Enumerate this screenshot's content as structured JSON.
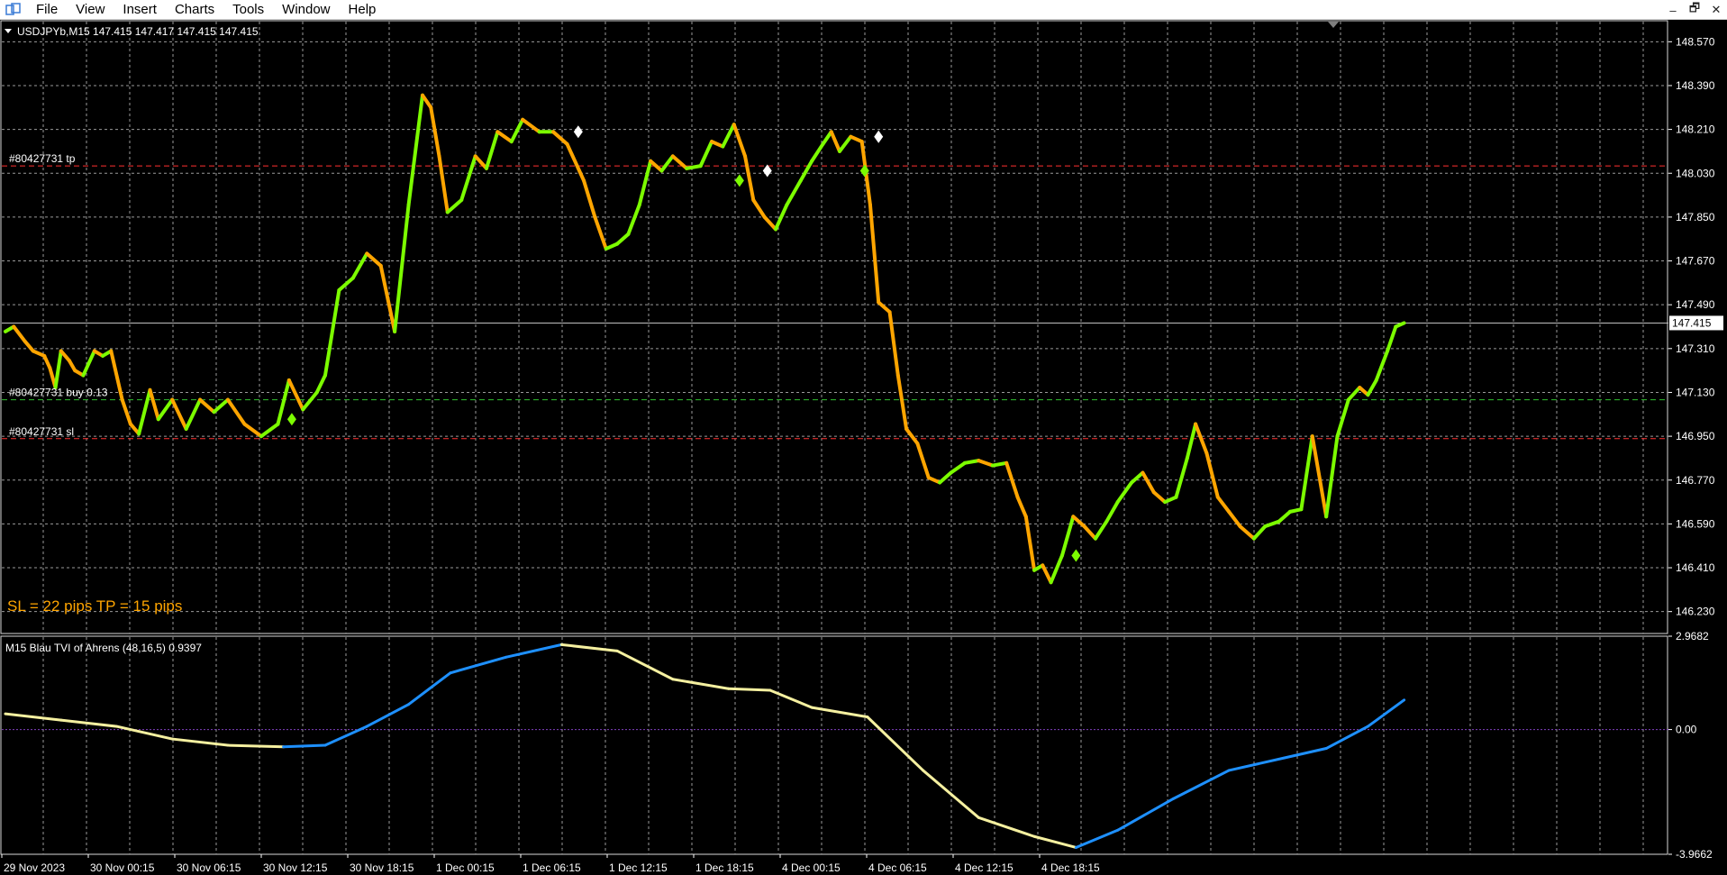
{
  "menu": {
    "items": [
      "File",
      "View",
      "Insert",
      "Charts",
      "Tools",
      "Window",
      "Help"
    ],
    "controls": [
      "–",
      "🗗",
      "✕"
    ]
  },
  "chart_data": [
    {
      "type": "line",
      "title": "USDJPYb,M15  147.415 147.417 147.415 147.415",
      "ylim": [
        146.14,
        148.66
      ],
      "y_ticks": [
        "148.570",
        "148.390",
        "148.210",
        "148.030",
        "147.850",
        "147.670",
        "147.490",
        "147.310",
        "147.130",
        "146.950",
        "146.770",
        "146.590",
        "146.410",
        "146.230"
      ],
      "x_ticks": [
        "29 Nov 2023",
        "30 Nov 00:15",
        "30 Nov 06:15",
        "30 Nov 12:15",
        "30 Nov 18:15",
        "1 Dec 00:15",
        "1 Dec 06:15",
        "1 Dec 12:15",
        "1 Dec 18:15",
        "4 Dec 00:15",
        "4 Dec 06:15",
        "4 Dec 12:15",
        "4 Dec 18:15"
      ],
      "current_price_label": "147.415",
      "current_price": 147.415,
      "levels": [
        {
          "label": "#80427731 tp",
          "value": 148.06,
          "color": "#ff3030"
        },
        {
          "label": "#80427731 buy 0.13",
          "value": 147.1,
          "color": "#30c030"
        },
        {
          "label": "#80427731 sl",
          "value": 146.94,
          "color": "#ff3030"
        }
      ],
      "annotation": "SL = 22 pips      TP = 15 pips",
      "colors": {
        "up": "#7cfc00",
        "down": "#ffa500",
        "grid": "#9a9a9a",
        "background": "#000000"
      },
      "series": [
        {
          "x": 0,
          "y": 147.38
        },
        {
          "x": 0.3,
          "y": 147.4
        },
        {
          "x": 0.7,
          "y": 147.34
        },
        {
          "x": 1.0,
          "y": 147.3
        },
        {
          "x": 1.4,
          "y": 147.28
        },
        {
          "x": 1.6,
          "y": 147.23
        },
        {
          "x": 1.8,
          "y": 147.15
        },
        {
          "x": 2.0,
          "y": 147.3
        },
        {
          "x": 2.3,
          "y": 147.26
        },
        {
          "x": 2.5,
          "y": 147.22
        },
        {
          "x": 2.8,
          "y": 147.2
        },
        {
          "x": 3.2,
          "y": 147.3
        },
        {
          "x": 3.5,
          "y": 147.28
        },
        {
          "x": 3.8,
          "y": 147.3
        },
        {
          "x": 4.2,
          "y": 147.1
        },
        {
          "x": 4.5,
          "y": 147.0
        },
        {
          "x": 4.8,
          "y": 146.96
        },
        {
          "x": 5.2,
          "y": 147.14
        },
        {
          "x": 5.5,
          "y": 147.02
        },
        {
          "x": 6.0,
          "y": 147.1
        },
        {
          "x": 6.5,
          "y": 146.98
        },
        {
          "x": 7.0,
          "y": 147.1
        },
        {
          "x": 7.5,
          "y": 147.05
        },
        {
          "x": 8.0,
          "y": 147.1
        },
        {
          "x": 8.6,
          "y": 147.0
        },
        {
          "x": 9.2,
          "y": 146.95
        },
        {
          "x": 9.8,
          "y": 147.0
        },
        {
          "x": 10.2,
          "y": 147.18
        },
        {
          "x": 10.7,
          "y": 147.06
        },
        {
          "x": 11.2,
          "y": 147.13
        },
        {
          "x": 11.5,
          "y": 147.2
        },
        {
          "x": 12.0,
          "y": 147.55
        },
        {
          "x": 12.5,
          "y": 147.6
        },
        {
          "x": 13.0,
          "y": 147.7
        },
        {
          "x": 13.5,
          "y": 147.65
        },
        {
          "x": 14.0,
          "y": 147.38
        },
        {
          "x": 14.5,
          "y": 147.9
        },
        {
          "x": 15.0,
          "y": 148.35
        },
        {
          "x": 15.3,
          "y": 148.3
        },
        {
          "x": 15.6,
          "y": 148.1
        },
        {
          "x": 15.9,
          "y": 147.87
        },
        {
          "x": 16.4,
          "y": 147.92
        },
        {
          "x": 16.9,
          "y": 148.1
        },
        {
          "x": 17.3,
          "y": 148.05
        },
        {
          "x": 17.7,
          "y": 148.2
        },
        {
          "x": 18.2,
          "y": 148.16
        },
        {
          "x": 18.6,
          "y": 148.25
        },
        {
          "x": 19.2,
          "y": 148.2
        },
        {
          "x": 19.7,
          "y": 148.2
        },
        {
          "x": 20.2,
          "y": 148.15
        },
        {
          "x": 20.8,
          "y": 148.0
        },
        {
          "x": 21.2,
          "y": 147.85
        },
        {
          "x": 21.6,
          "y": 147.72
        },
        {
          "x": 22.0,
          "y": 147.74
        },
        {
          "x": 22.4,
          "y": 147.78
        },
        {
          "x": 22.8,
          "y": 147.9
        },
        {
          "x": 23.2,
          "y": 148.08
        },
        {
          "x": 23.6,
          "y": 148.04
        },
        {
          "x": 24.0,
          "y": 148.1
        },
        {
          "x": 24.5,
          "y": 148.05
        },
        {
          "x": 25.0,
          "y": 148.06
        },
        {
          "x": 25.4,
          "y": 148.16
        },
        {
          "x": 25.8,
          "y": 148.14
        },
        {
          "x": 26.2,
          "y": 148.23
        },
        {
          "x": 26.6,
          "y": 148.1
        },
        {
          "x": 26.9,
          "y": 147.92
        },
        {
          "x": 27.3,
          "y": 147.85
        },
        {
          "x": 27.7,
          "y": 147.8
        },
        {
          "x": 28.1,
          "y": 147.9
        },
        {
          "x": 28.6,
          "y": 148.0
        },
        {
          "x": 29.0,
          "y": 148.08
        },
        {
          "x": 29.4,
          "y": 148.15
        },
        {
          "x": 29.7,
          "y": 148.2
        },
        {
          "x": 30.0,
          "y": 148.12
        },
        {
          "x": 30.4,
          "y": 148.18
        },
        {
          "x": 30.8,
          "y": 148.16
        },
        {
          "x": 31.1,
          "y": 147.9
        },
        {
          "x": 31.4,
          "y": 147.5
        },
        {
          "x": 31.8,
          "y": 147.46
        },
        {
          "x": 32.1,
          "y": 147.2
        },
        {
          "x": 32.4,
          "y": 146.98
        },
        {
          "x": 32.8,
          "y": 146.92
        },
        {
          "x": 33.2,
          "y": 146.78
        },
        {
          "x": 33.6,
          "y": 146.76
        },
        {
          "x": 34.0,
          "y": 146.8
        },
        {
          "x": 34.5,
          "y": 146.84
        },
        {
          "x": 35.0,
          "y": 146.85
        },
        {
          "x": 35.5,
          "y": 146.83
        },
        {
          "x": 36.0,
          "y": 146.84
        },
        {
          "x": 36.4,
          "y": 146.7
        },
        {
          "x": 36.7,
          "y": 146.62
        },
        {
          "x": 37.0,
          "y": 146.4
        },
        {
          "x": 37.3,
          "y": 146.42
        },
        {
          "x": 37.6,
          "y": 146.35
        },
        {
          "x": 38.0,
          "y": 146.46
        },
        {
          "x": 38.4,
          "y": 146.62
        },
        {
          "x": 38.8,
          "y": 146.58
        },
        {
          "x": 39.2,
          "y": 146.53
        },
        {
          "x": 39.6,
          "y": 146.6
        },
        {
          "x": 40.0,
          "y": 146.68
        },
        {
          "x": 40.5,
          "y": 146.76
        },
        {
          "x": 40.9,
          "y": 146.8
        },
        {
          "x": 41.3,
          "y": 146.72
        },
        {
          "x": 41.7,
          "y": 146.68
        },
        {
          "x": 42.1,
          "y": 146.7
        },
        {
          "x": 42.5,
          "y": 146.86
        },
        {
          "x": 42.8,
          "y": 147.0
        },
        {
          "x": 43.2,
          "y": 146.88
        },
        {
          "x": 43.6,
          "y": 146.7
        },
        {
          "x": 44.0,
          "y": 146.64
        },
        {
          "x": 44.4,
          "y": 146.58
        },
        {
          "x": 44.9,
          "y": 146.53
        },
        {
          "x": 45.3,
          "y": 146.58
        },
        {
          "x": 45.8,
          "y": 146.6
        },
        {
          "x": 46.2,
          "y": 146.64
        },
        {
          "x": 46.6,
          "y": 146.65
        },
        {
          "x": 47.0,
          "y": 146.95
        },
        {
          "x": 47.5,
          "y": 146.62
        },
        {
          "x": 47.9,
          "y": 146.95
        },
        {
          "x": 48.3,
          "y": 147.1
        },
        {
          "x": 48.7,
          "y": 147.15
        },
        {
          "x": 49.0,
          "y": 147.12
        },
        {
          "x": 49.3,
          "y": 147.18
        },
        {
          "x": 49.7,
          "y": 147.3
        },
        {
          "x": 50.0,
          "y": 147.4
        },
        {
          "x": 50.3,
          "y": 147.415
        }
      ],
      "signal_markers": [
        {
          "x": 10.3,
          "y": 147.02,
          "color": "#7cfc00"
        },
        {
          "x": 20.6,
          "y": 148.2,
          "color": "#ffffff"
        },
        {
          "x": 26.4,
          "y": 148.0,
          "color": "#7cfc00"
        },
        {
          "x": 27.4,
          "y": 148.04,
          "color": "#ffffff"
        },
        {
          "x": 30.9,
          "y": 148.04,
          "color": "#7cfc00"
        },
        {
          "x": 31.4,
          "y": 148.18,
          "color": "#ffffff"
        },
        {
          "x": 38.5,
          "y": 146.46,
          "color": "#7cfc00"
        }
      ]
    },
    {
      "type": "line",
      "title": "M15 Blau TVI of Ahrens (48,16,5) 0.9397",
      "ylim": [
        -3.9662,
        2.9682
      ],
      "y_ticks": [
        "2.9682",
        "0.00",
        "-3.9662"
      ],
      "zero_line": 0.0,
      "colors": {
        "up": "#1e90ff",
        "down": "#f5f0a0",
        "zero": "#8040c0"
      },
      "series": [
        {
          "x": 0,
          "y": 0.5
        },
        {
          "x": 2,
          "y": 0.3
        },
        {
          "x": 4,
          "y": 0.1
        },
        {
          "x": 6,
          "y": -0.3
        },
        {
          "x": 8,
          "y": -0.5
        },
        {
          "x": 10,
          "y": -0.55
        },
        {
          "x": 11.5,
          "y": -0.5
        },
        {
          "x": 13,
          "y": 0.1
        },
        {
          "x": 14.5,
          "y": 0.8
        },
        {
          "x": 16,
          "y": 1.8
        },
        {
          "x": 18,
          "y": 2.3
        },
        {
          "x": 20,
          "y": 2.7
        },
        {
          "x": 22,
          "y": 2.5
        },
        {
          "x": 24,
          "y": 1.6
        },
        {
          "x": 26,
          "y": 1.3
        },
        {
          "x": 27.5,
          "y": 1.25
        },
        {
          "x": 29,
          "y": 0.7
        },
        {
          "x": 31,
          "y": 0.4
        },
        {
          "x": 33,
          "y": -1.3
        },
        {
          "x": 35,
          "y": -2.8
        },
        {
          "x": 37,
          "y": -3.4
        },
        {
          "x": 38.5,
          "y": -3.75
        },
        {
          "x": 40,
          "y": -3.2
        },
        {
          "x": 42,
          "y": -2.2
        },
        {
          "x": 44,
          "y": -1.3
        },
        {
          "x": 46,
          "y": -0.9
        },
        {
          "x": 47.5,
          "y": -0.6
        },
        {
          "x": 49,
          "y": 0.1
        },
        {
          "x": 50.3,
          "y": 0.9397
        }
      ]
    }
  ]
}
